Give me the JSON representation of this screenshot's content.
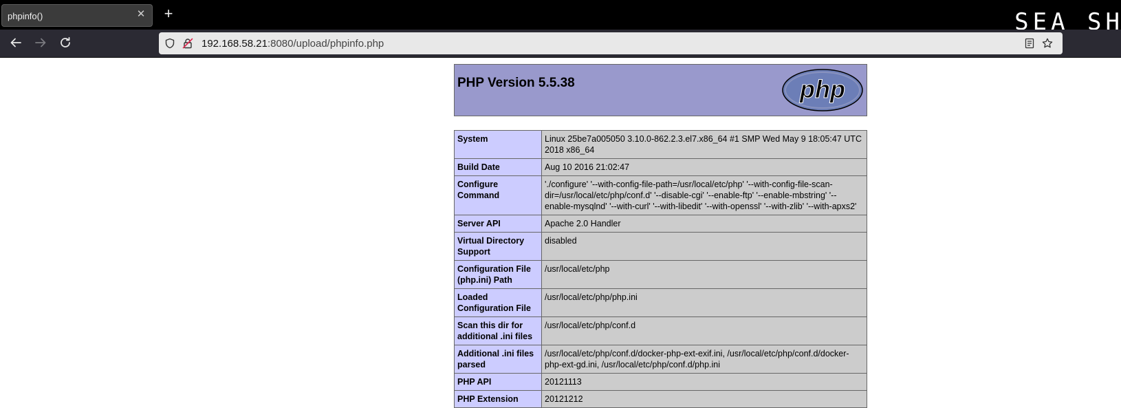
{
  "browser": {
    "tab_title": "phpinfo()",
    "tab_close_glyph": "✕",
    "new_tab_glyph": "+",
    "brand_text": "SEA SH",
    "url_host": "192.168.58.21",
    "url_rest": ":8080/upload/phpinfo.php",
    "icons": {
      "back": "back-arrow-icon",
      "forward": "forward-arrow-icon",
      "reload": "reload-icon",
      "tracking": "shield-icon",
      "security": "insecure-lock-icon",
      "reader": "reader-view-icon",
      "bookmark": "star-icon"
    }
  },
  "page": {
    "version_title": "PHP Version 5.5.38",
    "logo_text": "php",
    "colors": {
      "header_bg": "#9999cc",
      "label_bg": "#ccccff",
      "value_bg": "#cccccc",
      "logo_fill": "#6c7eb7"
    },
    "rows": [
      {
        "label": "System",
        "value": "Linux 25be7a005050 3.10.0-862.2.3.el7.x86_64 #1 SMP Wed May 9 18:05:47 UTC 2018 x86_64"
      },
      {
        "label": "Build Date",
        "value": "Aug 10 2016 21:02:47"
      },
      {
        "label": "Configure Command",
        "value": "'./configure' '--with-config-file-path=/usr/local/etc/php' '--with-config-file-scan-dir=/usr/local/etc/php/conf.d' '--disable-cgi' '--enable-ftp' '--enable-mbstring' '--enable-mysqlnd' '--with-curl' '--with-libedit' '--with-openssl' '--with-zlib' '--with-apxs2'"
      },
      {
        "label": "Server API",
        "value": "Apache 2.0 Handler"
      },
      {
        "label": "Virtual Directory Support",
        "value": "disabled"
      },
      {
        "label": "Configuration File (php.ini) Path",
        "value": "/usr/local/etc/php"
      },
      {
        "label": "Loaded Configuration File",
        "value": "/usr/local/etc/php/php.ini"
      },
      {
        "label": "Scan this dir for additional .ini files",
        "value": "/usr/local/etc/php/conf.d"
      },
      {
        "label": "Additional .ini files parsed",
        "value": "/usr/local/etc/php/conf.d/docker-php-ext-exif.ini, /usr/local/etc/php/conf.d/docker-php-ext-gd.ini, /usr/local/etc/php/conf.d/php.ini"
      },
      {
        "label": "PHP API",
        "value": "20121113"
      },
      {
        "label": "PHP Extension",
        "value": "20121212"
      }
    ]
  }
}
